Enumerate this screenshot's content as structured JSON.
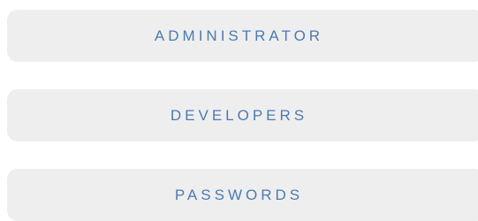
{
  "menu": {
    "items": [
      {
        "label": "ADMINISTRATOR"
      },
      {
        "label": "DEVELOPERS"
      },
      {
        "label": "PASSWORDS"
      }
    ]
  },
  "colors": {
    "button_background": "#eeeeee",
    "label_text": "#4b7bb4",
    "page_background": "#ffffff"
  }
}
